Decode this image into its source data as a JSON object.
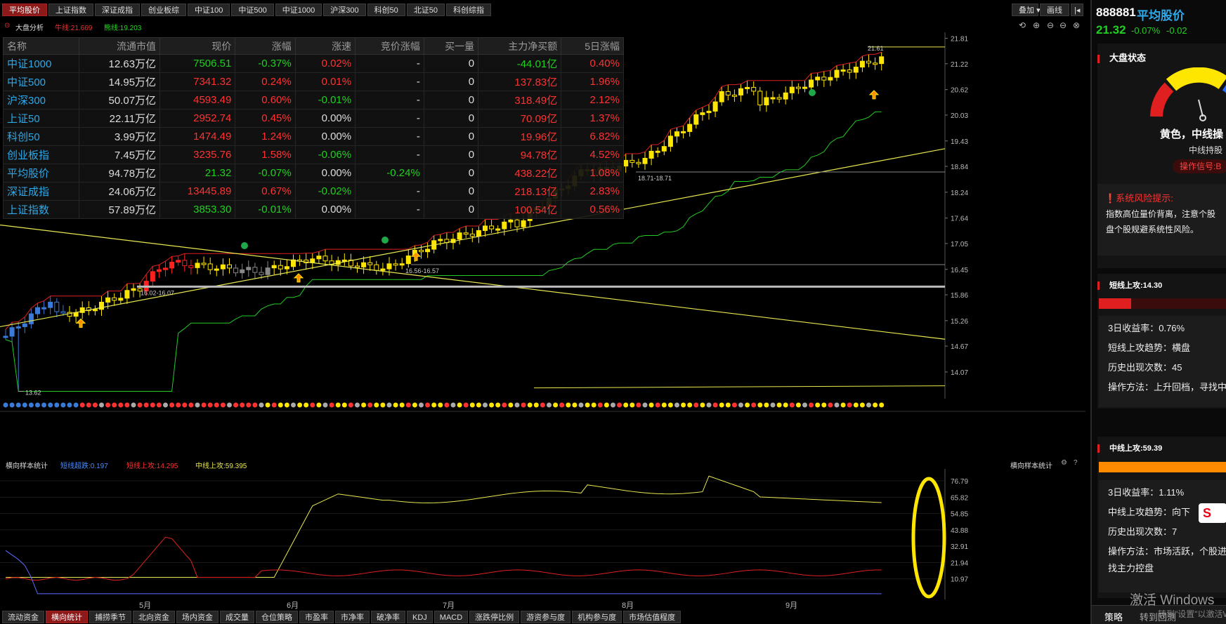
{
  "top_tabs": [
    "平均股价",
    "上证指数",
    "深证成指",
    "创业板综",
    "中证100",
    "中证500",
    "中证1000",
    "沪深300",
    "科创50",
    "北证50",
    "科创综指"
  ],
  "top_right": {
    "overlay": "叠加",
    "draw": "画线"
  },
  "chart_header": {
    "analysis": "大盘分析",
    "bull": "牛线:21.669",
    "bear": "熊线:19.203"
  },
  "table": {
    "headers": [
      "名称",
      "流通市值",
      "现价",
      "涨幅",
      "涨速",
      "竞价涨幅",
      "买一量",
      "主力净买额",
      "5日涨幅"
    ],
    "rows": [
      {
        "name": "中证1000",
        "cap": "12.63万亿",
        "price": "7506.51",
        "chg": "-0.37%",
        "speed": "0.02%",
        "bid": "-",
        "buy1": "0",
        "net": "-44.01亿",
        "d5": "0.40%"
      },
      {
        "name": "中证500",
        "cap": "14.95万亿",
        "price": "7341.32",
        "chg": "0.24%",
        "speed": "0.01%",
        "bid": "-",
        "buy1": "0",
        "net": "137.83亿",
        "d5": "1.96%"
      },
      {
        "name": "沪深300",
        "cap": "50.07万亿",
        "price": "4593.49",
        "chg": "0.60%",
        "speed": "-0.01%",
        "bid": "-",
        "buy1": "0",
        "net": "318.49亿",
        "d5": "2.12%"
      },
      {
        "name": "上证50",
        "cap": "22.11万亿",
        "price": "2952.74",
        "chg": "0.45%",
        "speed": "0.00%",
        "bid": "-",
        "buy1": "0",
        "net": "70.09亿",
        "d5": "1.37%"
      },
      {
        "name": "科创50",
        "cap": "3.99万亿",
        "price": "1474.49",
        "chg": "1.24%",
        "speed": "0.00%",
        "bid": "-",
        "buy1": "0",
        "net": "19.96亿",
        "d5": "6.82%"
      },
      {
        "name": "创业板指",
        "cap": "7.45万亿",
        "price": "3235.76",
        "chg": "1.58%",
        "speed": "-0.06%",
        "bid": "-",
        "buy1": "0",
        "net": "94.78亿",
        "d5": "4.52%"
      },
      {
        "name": "平均股价",
        "cap": "94.78万亿",
        "price": "21.32",
        "chg": "-0.07%",
        "speed": "0.00%",
        "bid": "-0.24%",
        "buy1": "0",
        "net": "438.22亿",
        "d5": "1.08%"
      },
      {
        "name": "深证成指",
        "cap": "24.06万亿",
        "price": "13445.89",
        "chg": "0.67%",
        "speed": "-0.02%",
        "bid": "-",
        "buy1": "0",
        "net": "218.13亿",
        "d5": "2.83%"
      },
      {
        "name": "上证指数",
        "cap": "57.89万亿",
        "price": "3853.30",
        "chg": "-0.01%",
        "speed": "0.00%",
        "bid": "-",
        "buy1": "0",
        "net": "100.54亿",
        "d5": "0.56%"
      }
    ]
  },
  "main_chart": {
    "y_ticks": [
      "21.81",
      "21.22",
      "20.62",
      "20.03",
      "19.43",
      "18.84",
      "18.24",
      "17.64",
      "17.05",
      "16.45",
      "15.86",
      "15.26",
      "14.67",
      "14.07"
    ],
    "annotations": {
      "low": "13.62",
      "zone1": "16.02-16.07",
      "zone2": "16.56-16.57",
      "zone3": "18.71-18.71",
      "high": "21.61"
    }
  },
  "lower": {
    "title": "横向样本统计",
    "l1": "短线超跌:0.197",
    "l2": "短线上攻:14.295",
    "l3": "中线上攻:59.395",
    "right_title": "横向样本统计",
    "y_ticks": [
      "76.79",
      "65.82",
      "54.85",
      "43.88",
      "32.91",
      "21.94",
      "10.97"
    ]
  },
  "x_axis": [
    "5月",
    "6月",
    "7月",
    "8月",
    "9月"
  ],
  "bottom_tabs": [
    "流动资金",
    "横向统计",
    "捕捞季节",
    "北向资金",
    "场内资金",
    "成交量",
    "仓位策略",
    "市盈率",
    "市净率",
    "破净率",
    "KDJ",
    "MACD",
    "涨跌停比例",
    "游资参与度",
    "机构参与度",
    "市场估值程度"
  ],
  "bottom_active": 1,
  "sidebar": {
    "code": "888881",
    "name": "平均股价",
    "price": "21.32",
    "chg_pct": "-0.07%",
    "chg": "-0.02",
    "market_title": "大盘状态",
    "gauge_text": "黄色，中线操",
    "gauge_sub": "中线持股",
    "signal": "操作信号:B",
    "risk_title": "系统风险提示:",
    "risk_text": [
      "指数高位量价背离，注意个股",
      "盘个股规避系统性风险。"
    ],
    "short_title": "短线上攻:14.30",
    "short_lines": [
      "3日收益率：0.76%",
      "短线上攻趋势：横盘",
      "历史出现次数：45",
      "操作方法：上升回档，寻找中线"
    ],
    "mid_title": "中线上攻:59.39",
    "mid_lines": [
      "3日收益率：1.11%",
      "中线上攻趋势：向下",
      "历史出现次数：7",
      "操作方法：市场活跃，个股进入",
      "找主力控盘"
    ],
    "bottom_tab": "策略",
    "bottom_link": "转到回测",
    "watermark1": "激活 Windows",
    "watermark2": "转到\"设置\"以激活Windows"
  }
}
